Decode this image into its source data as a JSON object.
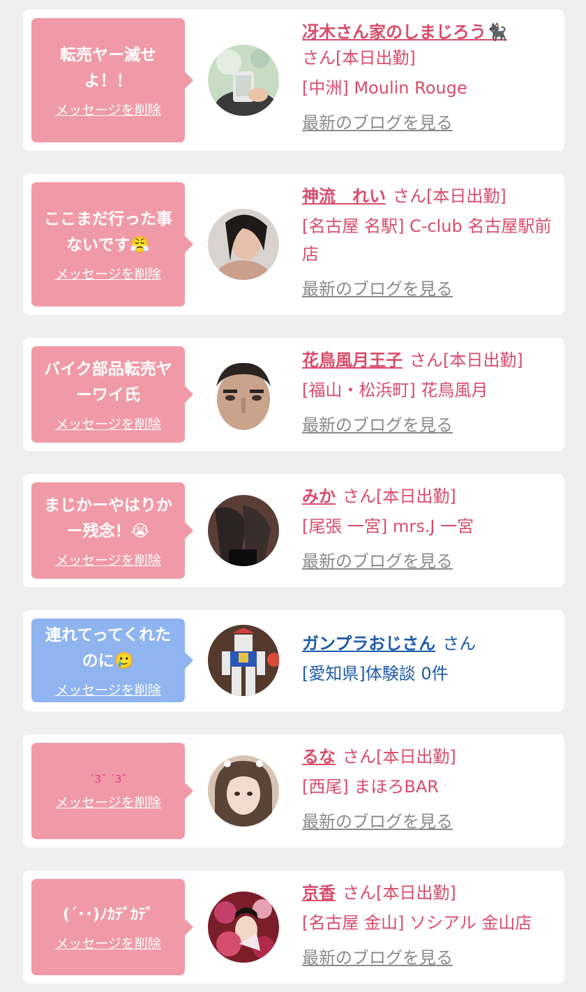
{
  "delete_label": "メッセージを削除",
  "blog_label": "最新のブログを見る",
  "colors": {
    "pink_bubble": "#f09aa7",
    "blue_bubble": "#8fb4ef",
    "name_pink": "#d94b6a",
    "name_blue": "#1e5aa8",
    "blog_gray": "#8a8a8a"
  },
  "cards": [
    {
      "message": "転売ヤー滅せよ！！",
      "name": "冴木さん家のしまじろう🐈‍⬛",
      "suffix": "さん[本日出勤]",
      "shop": "[中洲] Moulin Rouge",
      "avatar_icon": "selfie-photo-icon"
    },
    {
      "message": "ここまだ行った事ないです😤",
      "name": "神流　れい",
      "suffix": "さん[本日出勤]",
      "shop": "[名古屋 名駅] C-club 名古屋駅前店",
      "avatar_icon": "portrait-photo-icon"
    },
    {
      "message": "バイク部品転売ヤーワイ氏",
      "name": "花鳥風月王子",
      "suffix": "さん[本日出勤]",
      "shop": "[福山・松浜町] 花鳥風月",
      "avatar_icon": "face-closeup-icon"
    },
    {
      "message": "まじかーやはりかー残念！😭",
      "name": "みか",
      "suffix": "さん[本日出勤]",
      "shop": "[尾張 一宮] mrs.J 一宮",
      "avatar_icon": "legs-photo-icon"
    },
    {
      "message": "連れてってくれたのに🥲",
      "name": "ガンプラおじさん",
      "suffix": "さん",
      "shop": "[愛知県]体験談 0件",
      "avatar_icon": "robot-model-icon"
    },
    {
      "message": "ˊ3˘ ˊ3˘",
      "name": "るな",
      "suffix": "さん[本日出勤]",
      "shop": "[西尾] まほろBAR",
      "avatar_icon": "girl-photo-icon"
    },
    {
      "message": "(´･･)ﾉｶﾃﾞｶﾃﾞ",
      "name": "京香",
      "suffix": "さん[本日出勤]",
      "shop": "[名古屋 金山] ソシアル 金山店",
      "avatar_icon": "kimono-photo-icon"
    }
  ]
}
